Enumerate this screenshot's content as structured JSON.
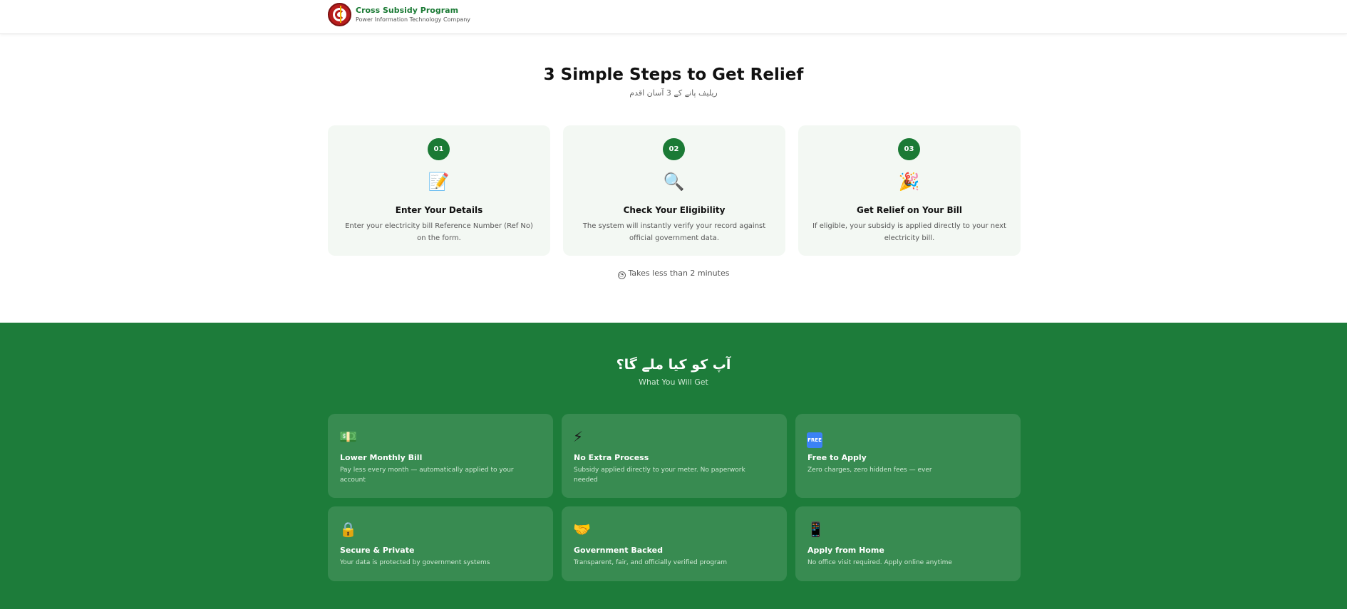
{
  "header": {
    "title": "Cross Subsidy Program",
    "subtitle": "Power Information Technology Company"
  },
  "steps": {
    "title": "3 Simple Steps to Get Relief",
    "subtitle_urdu": "ریلیف پانے کے 3 آسان اقدم",
    "items": [
      {
        "number": "01",
        "icon": "memo-icon",
        "title": "Enter Your Details",
        "description": "Enter your electricity bill Reference Number (Ref No) on the form."
      },
      {
        "number": "02",
        "icon": "magnifier-icon",
        "title": "Check Your Eligibility",
        "description": "The system will instantly verify your record against official government data."
      },
      {
        "number": "03",
        "icon": "party-popper-icon",
        "title": "Get Relief on Your Bill",
        "description": "If eligible, your subsidy is applied directly to your next electricity bill."
      }
    ],
    "timer_text": "Takes less than 2 minutes"
  },
  "benefits": {
    "title_urdu": "آپ کو کیا ملے گا؟",
    "subtitle": "What You Will Get",
    "items": [
      {
        "icon": "money-icon",
        "title": "Lower Monthly Bill",
        "description": "Pay less every month — automatically applied to your account"
      },
      {
        "icon": "lightning-icon",
        "title": "No Extra Process",
        "description": "Subsidy applied directly to your meter. No paperwork needed"
      },
      {
        "icon": "free-icon",
        "badge_text": "FREE",
        "title": "Free to Apply",
        "description": "Zero charges, zero hidden fees — ever"
      },
      {
        "icon": "lock-icon",
        "title": "Secure & Private",
        "description": "Your data is protected by government systems"
      },
      {
        "icon": "handshake-icon",
        "title": "Government Backed",
        "description": "Transparent, fair, and officially verified program"
      },
      {
        "icon": "phone-icon",
        "title": "Apply from Home",
        "description": "No office visit required. Apply online anytime"
      }
    ]
  },
  "colors": {
    "brand_green": "#1b7a35",
    "section_green": "#1d7c3a",
    "card_bg": "#f3f8f3"
  }
}
